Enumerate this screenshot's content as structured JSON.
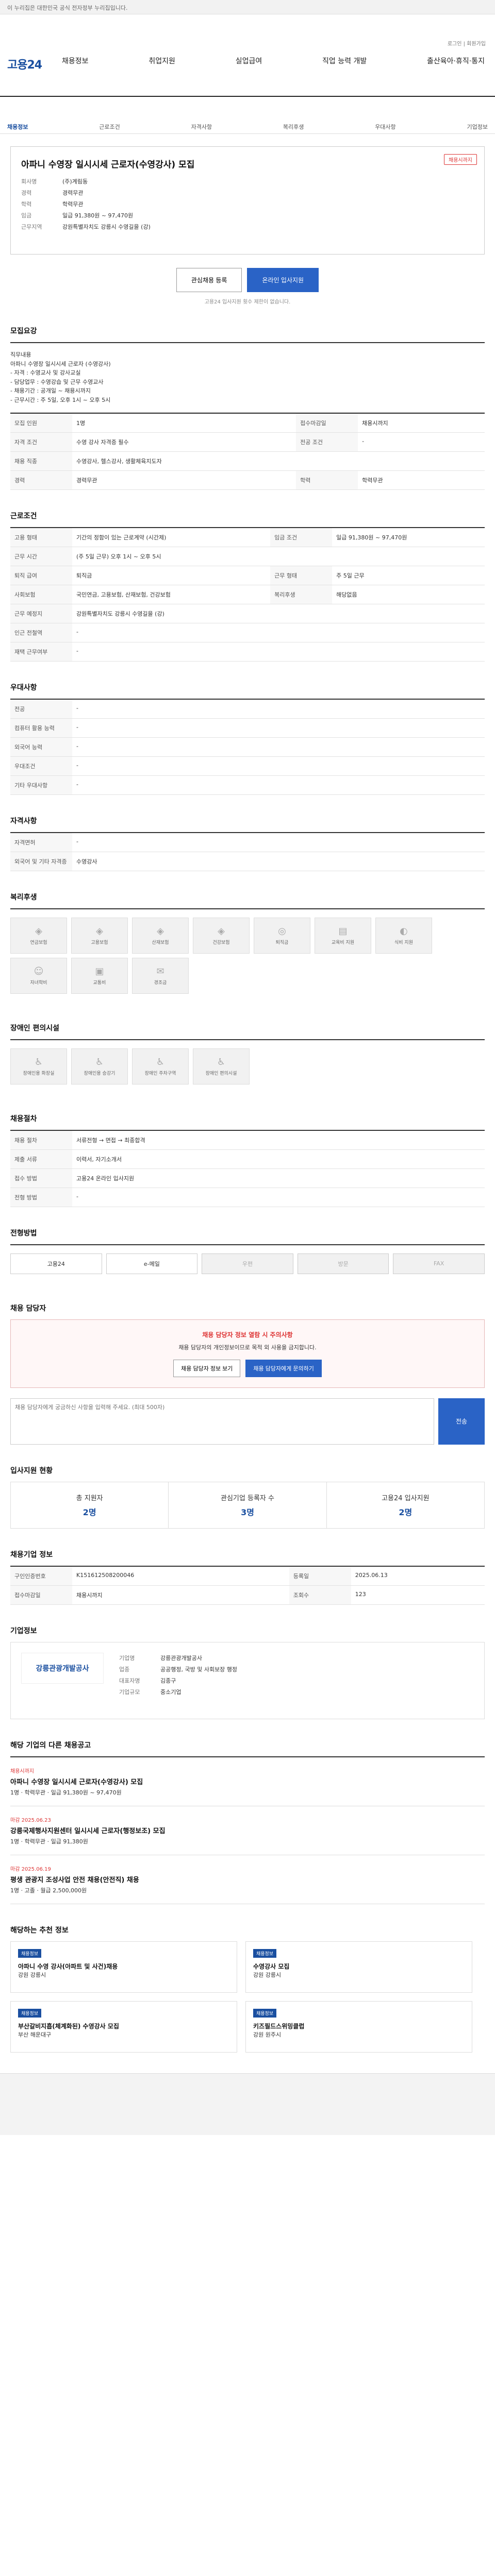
{
  "topbar": {
    "text": "이 누리집은 대한민국 공식 전자정부 누리집입니다."
  },
  "util": {
    "links": "로그인 | 회원가입"
  },
  "gnb": {
    "logo": "고용24",
    "menu": [
      "채용정보",
      "취업지원",
      "실업급여",
      "직업 능력 개발",
      "출산육아·휴직·통지"
    ]
  },
  "tabs": [
    "채용정보",
    "근로조건",
    "자격사항",
    "복리후생",
    "우대사항",
    "기업정보"
  ],
  "job": {
    "title": "아파니 수영장 일시시세 근로자(수영강사) 모집",
    "chip": "채용시까지",
    "company_label": "회사명",
    "company": "(주)계림동",
    "rows": [
      {
        "k": "경력",
        "v": "경력무관"
      },
      {
        "k": "학력",
        "v": "학력무관"
      },
      {
        "k": "임금",
        "v": "일급 91,380원 ~ 97,470원"
      },
      {
        "k": "근무지역",
        "v": "강원특별자치도 강릉시 수영길을 (강)"
      }
    ],
    "apply_label": "온라인 입사지원",
    "interest_label": "관심채용 등록",
    "note": "고용24 입사지원 횟수 제한이 없습니다."
  },
  "sections": {
    "recruit": "모집요강",
    "conditions": "근로조건",
    "prefer": "우대사항",
    "qual": "자격사항",
    "welfare": "복리후생",
    "disabled": "장애인 편의시설",
    "placement": "채용절차",
    "apply": "전형방법",
    "inquiry": "채용 담당자",
    "applicants": "입사지원 현황",
    "info": "채용기업 정보",
    "company": "기업정보",
    "other": "해당 기업의 다른 채용공고",
    "recommend": "해당하는 추천 정보"
  },
  "recruit_text": "직무내용\n아파니 수영장 일시시세 근로자 (수영강사)\n- 자격 : 수영교사 및 강사교실\n- 담당업무 : 수영강습 및 근무 수영교사\n- 채용기간 : 공개일 ~ 채용시까지\n- 근무시간 : 주 5일, 오후 1시 ~ 오후 5시",
  "recruit_table": [
    {
      "k": "모집 인원",
      "v": "1명",
      "k2": "접수마감일",
      "v2": "채용시까지"
    },
    {
      "k": "자격 조건",
      "v": "수영 강사 자격증 필수",
      "k2": "전공 조건",
      "v2": "-"
    },
    {
      "k": "채용 직종",
      "v": "수영강사, 헬스강사, 생활체육지도자",
      "k2": "",
      "v2": ""
    },
    {
      "k": "경력",
      "v": "경력무관",
      "k2": "학력",
      "v2": "학력무관"
    }
  ],
  "cond_table": [
    {
      "k": "고용 형태",
      "v": "기간의 정함이 있는 근로계약 (시간제)",
      "k2": "임금 조건",
      "v2": "일급 91,380원 ~ 97,470원"
    },
    {
      "k": "근무 시간",
      "v": "(주 5일 근무) 오후 1시 ~ 오후 5시",
      "k2": "",
      "v2": ""
    },
    {
      "k": "퇴직 급여",
      "v": "퇴직금",
      "k2": "근무 형태",
      "v2": "주 5일 근무"
    },
    {
      "k": "사회보험",
      "v": "국민연금, 고용보험, 산재보험, 건강보험",
      "k2": "복리후생",
      "v2": "해당없음"
    },
    {
      "k": "근무 예정지",
      "v": "강원특별자치도 강릉시 수영길을 (강)",
      "k2": "",
      "v2": ""
    },
    {
      "k": "인근 전철역",
      "v": "-",
      "k2": "",
      "v2": ""
    },
    {
      "k": "재택 근무여부",
      "v": "-",
      "k2": "",
      "v2": ""
    }
  ],
  "prefer_table": [
    {
      "k": "전공",
      "v": "-"
    },
    {
      "k": "컴퓨터 활용 능력",
      "v": "-"
    },
    {
      "k": "외국어 능력",
      "v": "-"
    },
    {
      "k": "우대조건",
      "v": "-"
    },
    {
      "k": "기타 우대사항",
      "v": "-"
    }
  ],
  "qual_table": [
    {
      "k": "자격면허",
      "v": "-"
    },
    {
      "k": "외국어 및 기타 자격증",
      "v": "수영강사"
    }
  ],
  "welfare_items": [
    "연금보험",
    "고용보험",
    "산재보험",
    "건강보험",
    "퇴직금",
    "교육비 지원",
    "식비 지원",
    "자녀학비",
    "교통비",
    "경조금"
  ],
  "disabled_items": [
    "장애인용 화장실",
    "장애인용 승강기",
    "장애인 주차구역",
    "장애인 편의시설"
  ],
  "placement_table": [
    {
      "k": "채용 절차",
      "v": "서류전형 → 면접 → 최종합격"
    },
    {
      "k": "제출 서류",
      "v": "이력서, 자기소개서"
    },
    {
      "k": "접수 방법",
      "v": "고용24 온라인 입사지원"
    },
    {
      "k": "전형 방법",
      "v": "-"
    }
  ],
  "apply_methods": [
    "고용24",
    "e-메일",
    "우편",
    "방문",
    "FAX"
  ],
  "inquiry": {
    "notice": "채용 담당자 정보 열람 시 주의사항",
    "notice_body": "채용 담당자의 개인정보이므로 목적 외 사용을 금지합니다.",
    "btn1": "채용 담당자 정보 보기",
    "btn2": "채용 담당자에게 문의하기",
    "textarea_placeholder": "채용 담당자에게 궁금하신 사항을 입력해 주세요. (최대 500자)",
    "send": "전송"
  },
  "applicants": [
    {
      "label": "총 지원자",
      "n": "2명"
    },
    {
      "label": "관심기업 등록자 수",
      "n": "3명"
    },
    {
      "label": "고용24 입사지원",
      "n": "2명"
    }
  ],
  "info_table": [
    {
      "k": "구인인증번호",
      "v": "K151612508200046",
      "k2": "등록일",
      "v2": "2025.06.13"
    },
    {
      "k": "접수마감일",
      "v": "채용시까지",
      "k2": "조회수",
      "v2": "123"
    }
  ],
  "company": {
    "logo": "강릉관광개발공사",
    "rows": [
      {
        "k": "기업명",
        "v": "강릉관광개발공사"
      },
      {
        "k": "업종",
        "v": "공공행정, 국방 및 사회보장 행정"
      },
      {
        "k": "대표자명",
        "v": "김종구"
      },
      {
        "k": "기업규모",
        "v": "중소기업"
      }
    ]
  },
  "other_posts": [
    {
      "deadline": "채용시까지",
      "title": "아파니 수영장 일시시세 근로자(수영강사) 모집",
      "meta": "1명 · 학력무관 · 일급 91,380원 ~ 97,470원"
    },
    {
      "deadline": "마감 2025.06.23",
      "title": "강릉국제행사지원센터 일시시세 근로자(행정보조) 모집",
      "meta": "1명 · 학력무관 · 일급 91,380원"
    },
    {
      "deadline": "마감 2025.06.19",
      "title": "평생 관광지 조성사업 안전 채용(안전직) 채용",
      "meta": "1명 · 고졸 · 월급 2,500,000원"
    }
  ],
  "recommend": [
    {
      "tag": "채용정보",
      "title": "아파니 수영 강사(아파트 및 사건)채용",
      "meta": "강원 강릉시"
    },
    {
      "tag": "채용정보",
      "title": "수영강사 모집",
      "meta": "강원 강릉시"
    },
    {
      "tag": "채용정보",
      "title": "부산갈비지흡(체계화된) 수영강사 모집",
      "meta": "부산 해운대구"
    },
    {
      "tag": "채용정보",
      "title": "키즈필드스위밍클럽",
      "meta": "강원 원주시"
    }
  ]
}
